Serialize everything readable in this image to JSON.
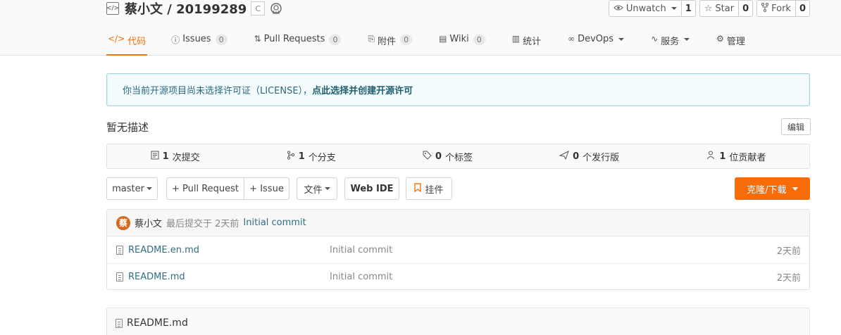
{
  "repo": {
    "title": "蔡小文 / 20199289",
    "lang_badge": "C"
  },
  "actions": {
    "watch": {
      "label": "Unwatch",
      "count": "1"
    },
    "star": {
      "label": "Star",
      "count": "0"
    },
    "fork": {
      "label": "Fork",
      "count": "0"
    }
  },
  "tabs": [
    {
      "label": "代码",
      "icon": "code-icon",
      "active": true
    },
    {
      "label": "Issues",
      "badge": "0",
      "icon": "issue-icon"
    },
    {
      "label": "Pull Requests",
      "badge": "0",
      "icon": "pull-request-icon"
    },
    {
      "label": "附件",
      "badge": "0",
      "icon": "attachment-icon"
    },
    {
      "label": "Wiki",
      "badge": "0",
      "icon": "wiki-icon"
    },
    {
      "label": "统计",
      "icon": "chart-icon"
    },
    {
      "label": "DevOps",
      "icon": "infinity-icon",
      "dropdown": true
    },
    {
      "label": "服务",
      "icon": "pulse-icon",
      "dropdown": true
    },
    {
      "label": "管理",
      "icon": "settings-doc-icon"
    }
  ],
  "notice": {
    "text": "你当前开源项目尚未选择许可证（LICENSE），",
    "link": "点此选择并创建开源许可"
  },
  "description": {
    "text": "暂无描述",
    "edit": "编辑"
  },
  "stats": [
    {
      "count": "1",
      "label": "次提交",
      "icon": "commit-icon"
    },
    {
      "count": "1",
      "label": "个分支",
      "icon": "branch-icon"
    },
    {
      "count": "0",
      "label": "个标签",
      "icon": "tag-icon"
    },
    {
      "count": "0",
      "label": "个发行版",
      "icon": "release-icon"
    },
    {
      "count": "1",
      "label": "位贡献者",
      "icon": "contributors-icon"
    }
  ],
  "toolbar": {
    "branch": "master",
    "pull_request": "+ Pull Request",
    "issue": "+ Issue",
    "file": "文件",
    "web_ide": "Web IDE",
    "widget": "挂件",
    "clone": "克隆/下载"
  },
  "last_commit": {
    "avatar": "蔡",
    "author": "蔡小文",
    "meta": "最后提交于 2天前",
    "message": "Initial commit"
  },
  "files": [
    {
      "name": "README.en.md",
      "message": "Initial commit",
      "time": "2天前"
    },
    {
      "name": "README.md",
      "message": "Initial commit",
      "time": "2天前"
    }
  ],
  "readme": {
    "title": "README.md"
  },
  "colors": {
    "accent": "#f0730b",
    "clone_button": "#f86d0a",
    "link": "#2f6f80"
  }
}
